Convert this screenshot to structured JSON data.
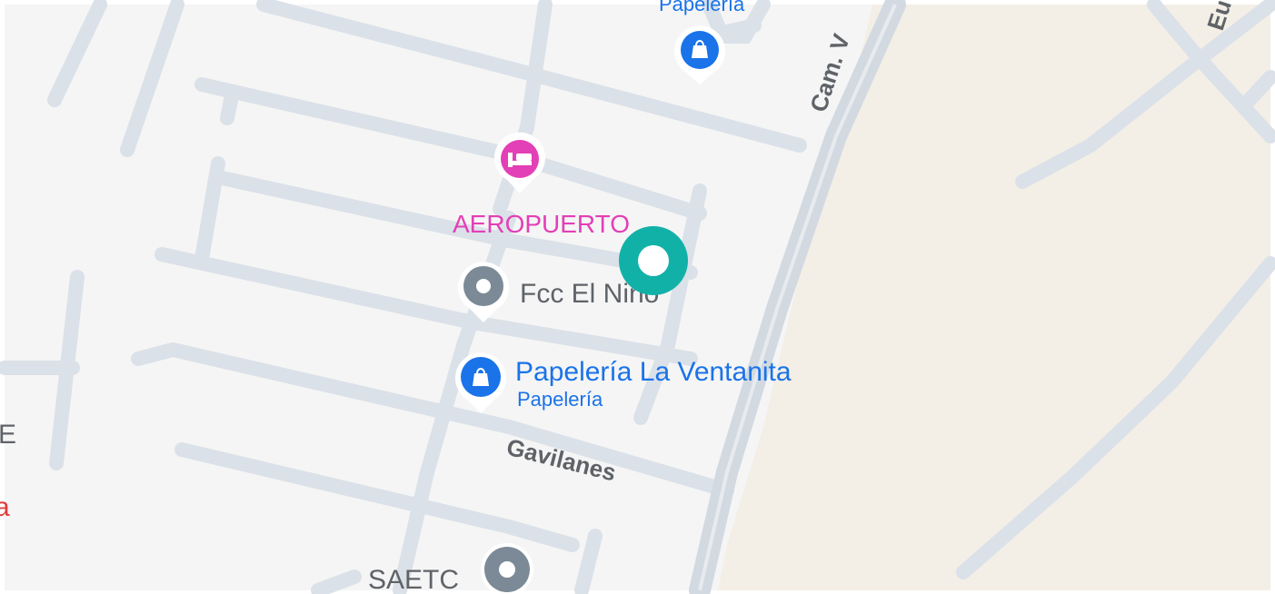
{
  "map": {
    "colors": {
      "land": "#f5f5f5",
      "sand": "#f3efe6",
      "road": "#dbe1e8",
      "road_major": "#d2d9e1",
      "street_text": "#5f6368",
      "shop_blue": "#1a73e8",
      "lodging_pink": "#e33fb6",
      "generic_gray": "#7b8a96",
      "location_teal": "#12b1a8",
      "red_fragment": "#e03c3c"
    },
    "streets": [
      {
        "id": "cam",
        "name": "Cam. V"
      },
      {
        "id": "gavilanes",
        "name": "Gavilanes"
      },
      {
        "id": "eu",
        "name": "Eu"
      }
    ],
    "places": [
      {
        "id": "papeleria-top",
        "name": "Papelería",
        "icon": "shopping-bag-icon"
      },
      {
        "id": "aeropuerto",
        "name": "AEROPUERTO",
        "icon": "bed-icon"
      },
      {
        "id": "fcc",
        "name": "Fcc El Niño",
        "icon": "dot-icon"
      },
      {
        "id": "ventanita",
        "name": "Papelería La Ventanita",
        "category": "Papelería",
        "icon": "shopping-bag-icon"
      },
      {
        "id": "saetc",
        "name": "SAETC",
        "icon": "dot-icon"
      }
    ],
    "edge_fragments": [
      "E",
      "a"
    ]
  }
}
